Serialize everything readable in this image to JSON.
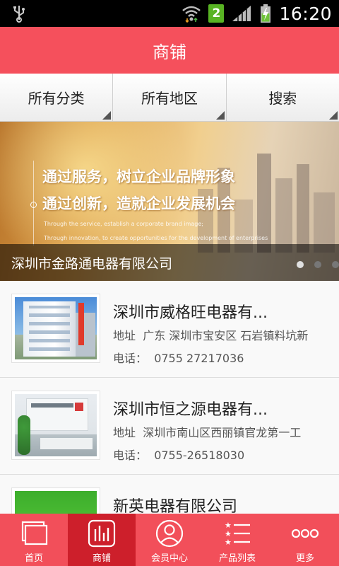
{
  "status_bar": {
    "time": "16:20",
    "sim_slot": "2",
    "icons": [
      "usb-icon",
      "wifi-icon",
      "signal-icon",
      "battery-charging-icon"
    ]
  },
  "header": {
    "title": "商铺"
  },
  "filters": [
    {
      "label": "所有分类"
    },
    {
      "label": "所有地区"
    },
    {
      "label": "搜索"
    }
  ],
  "banner": {
    "slogan_line1": "通过服务，树立企业品牌形象",
    "slogan_line2": "通过创新，造就企业发展机会",
    "english_line1": "Through the service, establish a corporate brand image;",
    "english_line2": "Through innovation, to create opportunities for the development of enterprises",
    "caption": "深圳市金路通电器有限公司",
    "slide_count": 3,
    "active_slide": 1
  },
  "shops": [
    {
      "name": "深圳市威格旺电器有...",
      "address_label": "地址",
      "address": "广东 深圳市宝安区 石岩镇料坑新",
      "phone_label": "电话：",
      "phone": "0755 27217036",
      "thumb": "building"
    },
    {
      "name": "深圳市恒之源电器有...",
      "address_label": "地址",
      "address": "深圳市南山区西丽镇官龙第一工",
      "phone_label": "电话：",
      "phone": "0755-26518030",
      "thumb": "office"
    },
    {
      "name": "新英电器有限公司",
      "address_label": "",
      "address": "",
      "phone_label": "",
      "phone": "",
      "thumb": "green"
    }
  ],
  "tabs": [
    {
      "label": "首页",
      "icon": "home-window-icon",
      "active": false
    },
    {
      "label": "商铺",
      "icon": "bar-chart-icon",
      "active": true
    },
    {
      "label": "会员中心",
      "icon": "user-icon",
      "active": false
    },
    {
      "label": "产品列表",
      "icon": "star-list-icon",
      "active": false
    },
    {
      "label": "更多",
      "icon": "more-dots-icon",
      "active": false
    }
  ],
  "colors": {
    "brand": "#f5505c",
    "tab_active": "#cd1f2b",
    "status_bar": "#000000"
  }
}
